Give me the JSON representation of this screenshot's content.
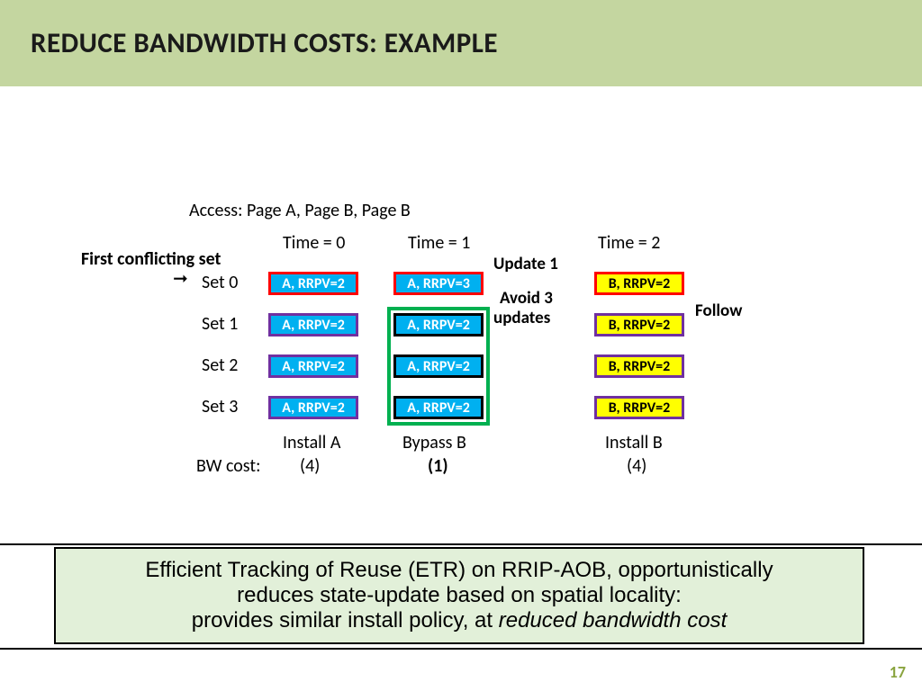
{
  "title": "REDUCE BANDWIDTH COSTS: EXAMPLE",
  "access_line": "Access: Page A, Page B, Page B",
  "first_conflict": "First conflicting set",
  "times": {
    "t0": "Time = 0",
    "t1": "Time = 1",
    "t2": "Time = 2"
  },
  "notes": {
    "update1": "Update 1",
    "avoid3a": "Avoid 3",
    "avoid3b": "updates",
    "follow": "Follow"
  },
  "sets": {
    "s0": "Set 0",
    "s1": "Set 1",
    "s2": "Set 2",
    "s3": "Set 3"
  },
  "cells": {
    "c0": "A, RRPV=2",
    "c1": "A, RRPV=3",
    "c2": "B, RRPV=2"
  },
  "actions": {
    "a0": "Install A",
    "a1": "Bypass B",
    "a2": "Install B"
  },
  "bw_label": "BW cost:",
  "bw": {
    "b0": "(4)",
    "b1": "(1)",
    "b2": "(4)"
  },
  "footer": {
    "l1a": "Efficient Tracking of Reuse (ETR) on RRIP-AOB, opportunistically",
    "l1b": "reduces state-update based on spatial locality:",
    "l2a": "provides similar install policy, at ",
    "l2b": "reduced bandwidth cost"
  },
  "page": "17"
}
